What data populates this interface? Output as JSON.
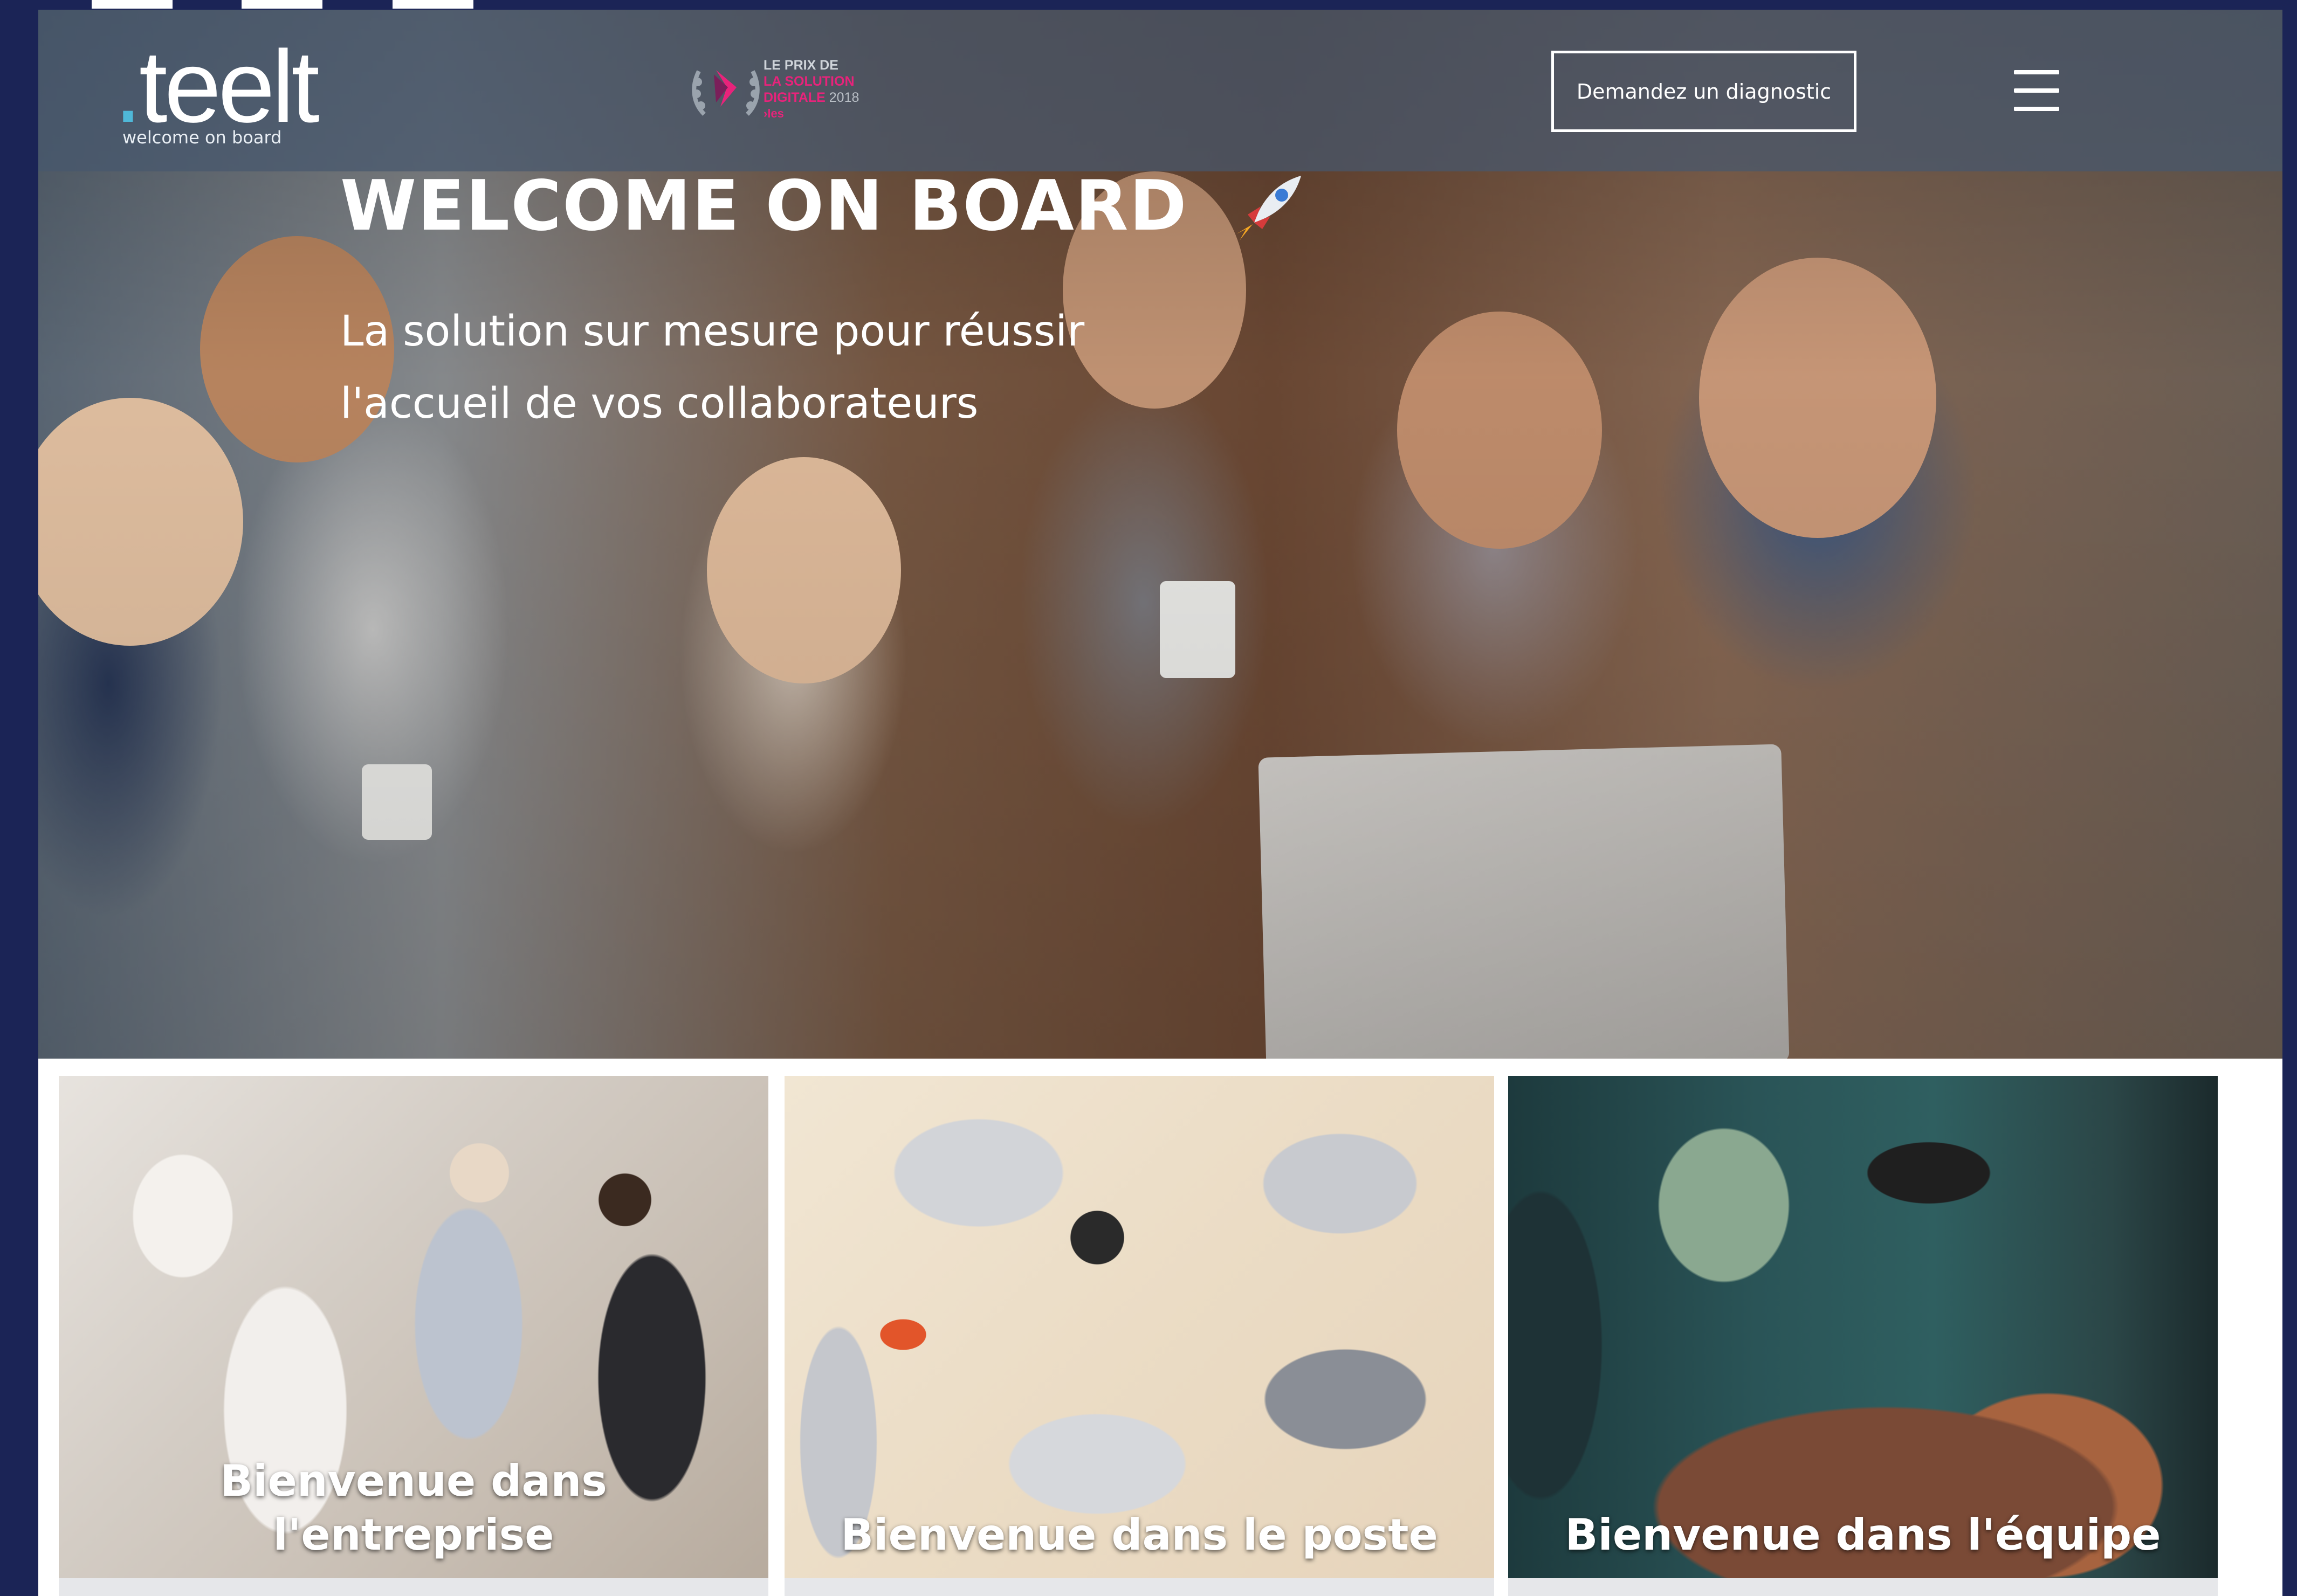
{
  "header": {
    "logo_word": "teelt",
    "logo_tagline": "welcome on board",
    "award": {
      "line1": "LE PRIX DE",
      "line2": "LA SOLUTION",
      "line3": "DIGITALE",
      "year": "2018",
      "line4": "›les"
    },
    "cta_label": "Demandez un diagnostic",
    "menu_icon": "hamburger-menu-icon"
  },
  "hero": {
    "title": "WELCOME ON BOARD",
    "title_icon": "rocket-icon",
    "subtitle_line1": "La solution sur mesure pour réussir",
    "subtitle_line2": "l'accueil de vos collaborateurs"
  },
  "cards": [
    {
      "title_line1": "Bienvenue dans",
      "title_line2": "l'entreprise"
    },
    {
      "title_line1": "Bienvenue dans le poste"
    },
    {
      "title_line1": "Bienvenue dans l'équipe"
    }
  ],
  "colors": {
    "frame": "#1b2456",
    "award_accent": "#e8237b",
    "logo_dot": "#4fb8d8"
  }
}
